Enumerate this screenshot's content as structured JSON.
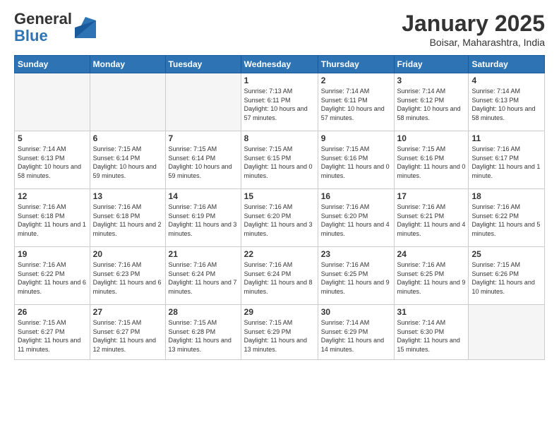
{
  "logo": {
    "general": "General",
    "blue": "Blue"
  },
  "header": {
    "month": "January 2025",
    "location": "Boisar, Maharashtra, India"
  },
  "days_of_week": [
    "Sunday",
    "Monday",
    "Tuesday",
    "Wednesday",
    "Thursday",
    "Friday",
    "Saturday"
  ],
  "weeks": [
    [
      {
        "day": "",
        "info": ""
      },
      {
        "day": "",
        "info": ""
      },
      {
        "day": "",
        "info": ""
      },
      {
        "day": "1",
        "info": "Sunrise: 7:13 AM\nSunset: 6:11 PM\nDaylight: 10 hours and 57 minutes."
      },
      {
        "day": "2",
        "info": "Sunrise: 7:14 AM\nSunset: 6:11 PM\nDaylight: 10 hours and 57 minutes."
      },
      {
        "day": "3",
        "info": "Sunrise: 7:14 AM\nSunset: 6:12 PM\nDaylight: 10 hours and 58 minutes."
      },
      {
        "day": "4",
        "info": "Sunrise: 7:14 AM\nSunset: 6:13 PM\nDaylight: 10 hours and 58 minutes."
      }
    ],
    [
      {
        "day": "5",
        "info": "Sunrise: 7:14 AM\nSunset: 6:13 PM\nDaylight: 10 hours and 58 minutes."
      },
      {
        "day": "6",
        "info": "Sunrise: 7:15 AM\nSunset: 6:14 PM\nDaylight: 10 hours and 59 minutes."
      },
      {
        "day": "7",
        "info": "Sunrise: 7:15 AM\nSunset: 6:14 PM\nDaylight: 10 hours and 59 minutes."
      },
      {
        "day": "8",
        "info": "Sunrise: 7:15 AM\nSunset: 6:15 PM\nDaylight: 11 hours and 0 minutes."
      },
      {
        "day": "9",
        "info": "Sunrise: 7:15 AM\nSunset: 6:16 PM\nDaylight: 11 hours and 0 minutes."
      },
      {
        "day": "10",
        "info": "Sunrise: 7:15 AM\nSunset: 6:16 PM\nDaylight: 11 hours and 0 minutes."
      },
      {
        "day": "11",
        "info": "Sunrise: 7:16 AM\nSunset: 6:17 PM\nDaylight: 11 hours and 1 minute."
      }
    ],
    [
      {
        "day": "12",
        "info": "Sunrise: 7:16 AM\nSunset: 6:18 PM\nDaylight: 11 hours and 1 minute."
      },
      {
        "day": "13",
        "info": "Sunrise: 7:16 AM\nSunset: 6:18 PM\nDaylight: 11 hours and 2 minutes."
      },
      {
        "day": "14",
        "info": "Sunrise: 7:16 AM\nSunset: 6:19 PM\nDaylight: 11 hours and 3 minutes."
      },
      {
        "day": "15",
        "info": "Sunrise: 7:16 AM\nSunset: 6:20 PM\nDaylight: 11 hours and 3 minutes."
      },
      {
        "day": "16",
        "info": "Sunrise: 7:16 AM\nSunset: 6:20 PM\nDaylight: 11 hours and 4 minutes."
      },
      {
        "day": "17",
        "info": "Sunrise: 7:16 AM\nSunset: 6:21 PM\nDaylight: 11 hours and 4 minutes."
      },
      {
        "day": "18",
        "info": "Sunrise: 7:16 AM\nSunset: 6:22 PM\nDaylight: 11 hours and 5 minutes."
      }
    ],
    [
      {
        "day": "19",
        "info": "Sunrise: 7:16 AM\nSunset: 6:22 PM\nDaylight: 11 hours and 6 minutes."
      },
      {
        "day": "20",
        "info": "Sunrise: 7:16 AM\nSunset: 6:23 PM\nDaylight: 11 hours and 6 minutes."
      },
      {
        "day": "21",
        "info": "Sunrise: 7:16 AM\nSunset: 6:24 PM\nDaylight: 11 hours and 7 minutes."
      },
      {
        "day": "22",
        "info": "Sunrise: 7:16 AM\nSunset: 6:24 PM\nDaylight: 11 hours and 8 minutes."
      },
      {
        "day": "23",
        "info": "Sunrise: 7:16 AM\nSunset: 6:25 PM\nDaylight: 11 hours and 9 minutes."
      },
      {
        "day": "24",
        "info": "Sunrise: 7:16 AM\nSunset: 6:25 PM\nDaylight: 11 hours and 9 minutes."
      },
      {
        "day": "25",
        "info": "Sunrise: 7:15 AM\nSunset: 6:26 PM\nDaylight: 11 hours and 10 minutes."
      }
    ],
    [
      {
        "day": "26",
        "info": "Sunrise: 7:15 AM\nSunset: 6:27 PM\nDaylight: 11 hours and 11 minutes."
      },
      {
        "day": "27",
        "info": "Sunrise: 7:15 AM\nSunset: 6:27 PM\nDaylight: 11 hours and 12 minutes."
      },
      {
        "day": "28",
        "info": "Sunrise: 7:15 AM\nSunset: 6:28 PM\nDaylight: 11 hours and 13 minutes."
      },
      {
        "day": "29",
        "info": "Sunrise: 7:15 AM\nSunset: 6:29 PM\nDaylight: 11 hours and 13 minutes."
      },
      {
        "day": "30",
        "info": "Sunrise: 7:14 AM\nSunset: 6:29 PM\nDaylight: 11 hours and 14 minutes."
      },
      {
        "day": "31",
        "info": "Sunrise: 7:14 AM\nSunset: 6:30 PM\nDaylight: 11 hours and 15 minutes."
      },
      {
        "day": "",
        "info": ""
      }
    ]
  ]
}
